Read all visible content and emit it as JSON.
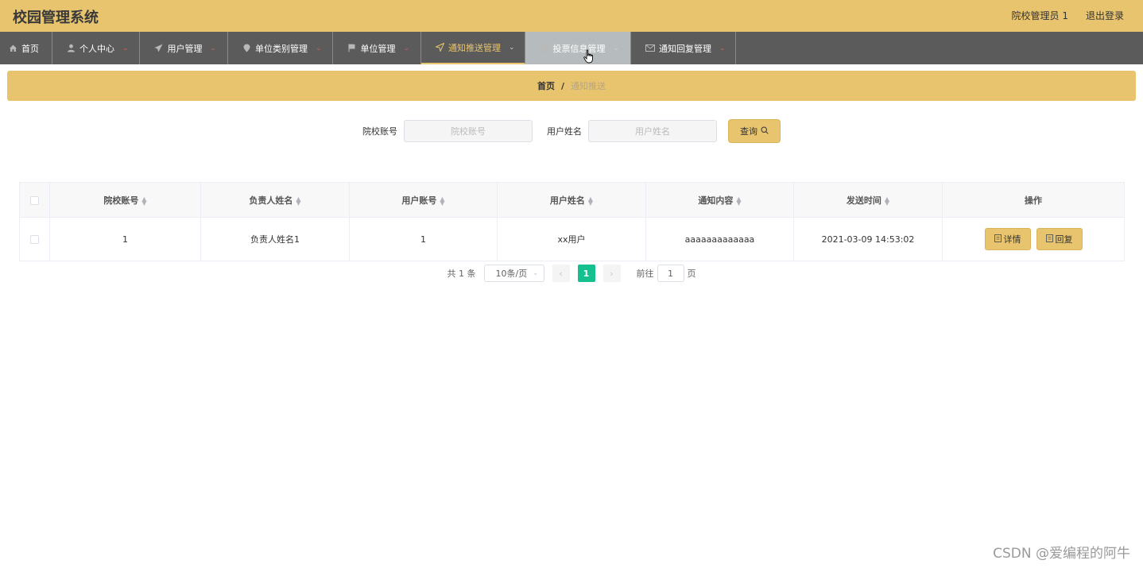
{
  "app": {
    "title": "校园管理系统",
    "user": "院校管理员 1",
    "logout": "退出登录"
  },
  "nav": [
    {
      "label": "首页",
      "icon": "home-icon",
      "caret": false
    },
    {
      "label": "个人中心",
      "icon": "user-icon",
      "caret": true
    },
    {
      "label": "用户管理",
      "icon": "paper-plane-icon",
      "caret": true
    },
    {
      "label": "单位类别管理",
      "icon": "map-pin-icon",
      "caret": true
    },
    {
      "label": "单位管理",
      "icon": "flag-icon",
      "caret": true
    },
    {
      "label": "通知推送管理",
      "icon": "send-icon",
      "caret": true,
      "state": "active"
    },
    {
      "label": "投票信息管理",
      "icon": "grid-icon",
      "caret": true,
      "state": "hover"
    },
    {
      "label": "通知回复管理",
      "icon": "mail-icon",
      "caret": true
    }
  ],
  "breadcrumb": {
    "home": "首页",
    "separator": "/",
    "current": "通知推送"
  },
  "search": {
    "field1_label": "院校账号",
    "field1_placeholder": "院校账号",
    "field1_value": "",
    "field2_label": "用户姓名",
    "field2_placeholder": "用户姓名",
    "field2_value": "",
    "button": "查询"
  },
  "table": {
    "headers": [
      "院校账号",
      "负责人姓名",
      "用户账号",
      "用户姓名",
      "通知内容",
      "发送时间",
      "操作"
    ],
    "rows": [
      {
        "cells": [
          "1",
          "负责人姓名1",
          "1",
          "xx用户",
          "aaaaaaaaaaaaa",
          "2021-03-09 14:53:02"
        ],
        "detail": "详情",
        "reply": "回复"
      }
    ]
  },
  "pager": {
    "total": "共 1 条",
    "page_size": "10条/页",
    "current_page": "1",
    "goto_label": "前往",
    "goto_value": "1",
    "page_suffix": "页"
  },
  "watermark": "CSDN @爱编程的阿牛",
  "colors": {
    "accent": "#e8c46e",
    "nav_bg": "#5b5b5b",
    "page_active": "#13c08e",
    "caret": "#e05a5a"
  }
}
